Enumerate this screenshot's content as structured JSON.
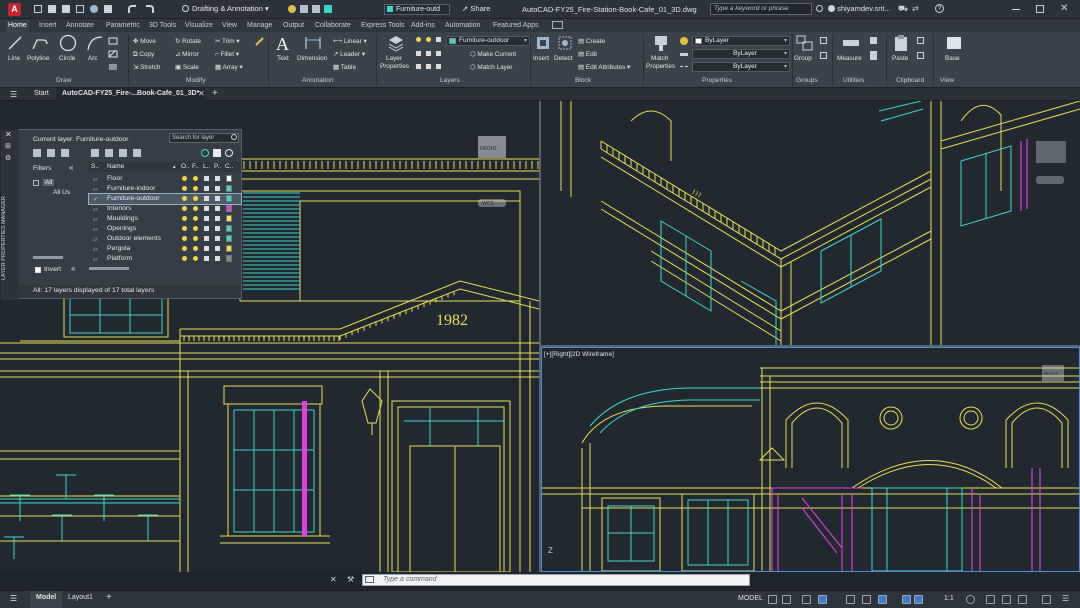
{
  "app_logo_letter": "A",
  "workspace": "Drafting & Annotation",
  "layer_quick": "Furniture-outd",
  "share_label": "Share",
  "doc_title": "AutoCAD-FY25_Fire-Station-Book-Cafe_01_3D.dwg",
  "search_placeholder": "Type a keyword or phrase",
  "user_name": "shiyamdev.srit...",
  "ribbon_tabs": [
    "Home",
    "Insert",
    "Annotate",
    "Parametric",
    "3D Tools",
    "Visualize",
    "View",
    "Manage",
    "Output",
    "Collaborate",
    "Express Tools",
    "Add-ins",
    "Automation",
    "Featured Apps"
  ],
  "draw": {
    "line": "Line",
    "polyline": "Polyline",
    "circle": "Circle",
    "arc": "Arc",
    "group": "Draw"
  },
  "modify": {
    "move": "Move",
    "rotate": "Rotate",
    "trim": "Trim",
    "copy": "Copy",
    "mirror": "Mirror",
    "fillet": "Fillet",
    "stretch": "Stretch",
    "scale": "Scale",
    "array": "Array",
    "group": "Modify"
  },
  "annotation": {
    "text": "Text",
    "dimension": "Dimension",
    "linear": "Linear",
    "leader": "Leader",
    "table": "Table",
    "group": "Annotation"
  },
  "layers": {
    "props": "Layer",
    "props2": "Properties",
    "current": "Furniture-outdoor",
    "make_current": "Make Current",
    "match_layer": "Match Layer",
    "group": "Layers"
  },
  "block": {
    "insert": "Insert",
    "detect": "Detect",
    "create": "Create",
    "edit": "Edit",
    "edit_attributes": "Edit Attributes",
    "group": "Block"
  },
  "properties": {
    "match": "Match",
    "match2": "Properties",
    "bylayer1": "ByLayer",
    "bylayer2": "ByLayer",
    "bylayer3": "ByLayer",
    "group": "Properties"
  },
  "groups": {
    "group": "Group",
    "label": "Groups"
  },
  "utilities": {
    "measure": "Measure",
    "label": "Utilities"
  },
  "clipboard": {
    "paste": "Paste",
    "label": "Clipboard"
  },
  "viewpanel": {
    "base": "Base",
    "label": "View"
  },
  "doc_tabs": {
    "start": "Start",
    "file": "AutoCAD-FY25_Fire-...Book-Cafe_01_3D*"
  },
  "lpm": {
    "current_layer": "Current layer: Furniture-outdoor",
    "search": "Search for layer",
    "filters": "Filters",
    "all": "All",
    "all_used": "All Us",
    "invert": "Invert",
    "status": "All: 17 layers displayed of 17 total layers",
    "side_title": "LAYER PROPERTIES MANAGER",
    "col_s": "S..",
    "col_name": "Name",
    "col_o": "O..",
    "col_f": "F..",
    "col_l": "L..",
    "col_p": "P..",
    "col_c": "C..",
    "layers": [
      {
        "name": "Floor",
        "color": "#ffffff"
      },
      {
        "name": "Furniture-indoor",
        "color": "#3fd6c8"
      },
      {
        "name": "Furniture-outdoor",
        "color": "#3fd6c8"
      },
      {
        "name": "Interiors",
        "color": "#e040e0"
      },
      {
        "name": "Mouldings",
        "color": "#f2e64b"
      },
      {
        "name": "Openings",
        "color": "#3fd6c8"
      },
      {
        "name": "Outdoor elements",
        "color": "#3fd6c8"
      },
      {
        "name": "Pergola",
        "color": "#e8e04a"
      },
      {
        "name": "Platform",
        "color": "#888888"
      }
    ]
  },
  "year_text": "1982",
  "viewport_label": "[+][Right][2D Wireframe]",
  "viewcube": {
    "front": "FRONT",
    "right": "RIGHT",
    "wcs": "WCS"
  },
  "cmd_placeholder": "Type a command",
  "status": {
    "model": "Model",
    "layout": "Layout1",
    "model_right": "MODEL",
    "scale": "1:1"
  },
  "colors": {
    "yellow": "#e8de52",
    "cyan": "#3fd6c8",
    "magenta": "#e040e0",
    "bg": "#212830",
    "accent": "#1f6fc2"
  }
}
